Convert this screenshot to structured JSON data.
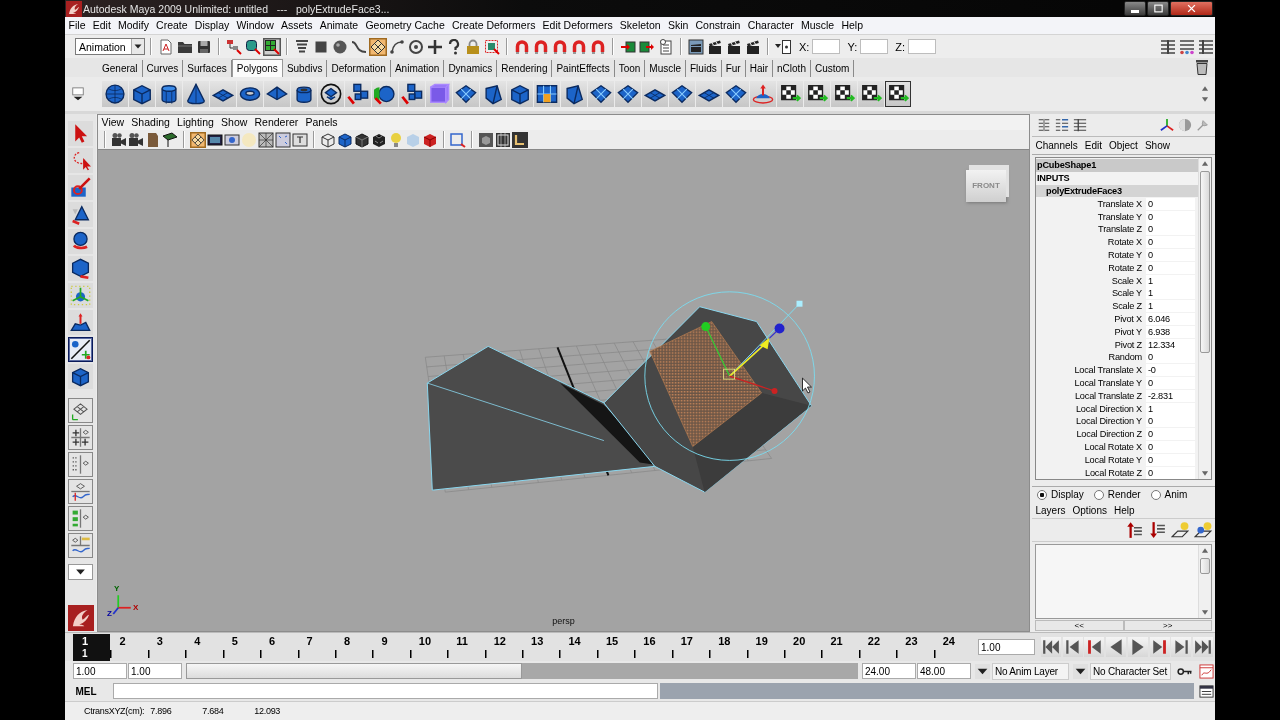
{
  "window": {
    "title": "Autodesk Maya 2009 Unlimited: untitled   ---   polyExtrudeFace3..."
  },
  "menu_bar": [
    "File",
    "Edit",
    "Modify",
    "Create",
    "Display",
    "Window",
    "Assets",
    "Animate",
    "Geometry Cache",
    "Create Deformers",
    "Edit Deformers",
    "Skeleton",
    "Skin",
    "Constrain",
    "Character",
    "Muscle",
    "Help"
  ],
  "status_line": {
    "menu_set": "Animation",
    "selection_modes": [
      {
        "selected": false
      },
      {
        "selected": false
      },
      {
        "selected": true
      }
    ],
    "snap_buttons": [
      {
        "on": true
      },
      {
        "on": false
      },
      {
        "on": false
      }
    ],
    "coordinate_fields": [
      {
        "label": "X:"
      },
      {
        "label": "Y:"
      },
      {
        "label": "Z:"
      }
    ]
  },
  "shelf": {
    "tabs": [
      {
        "label": "General",
        "selected": false
      },
      {
        "label": "Curves",
        "selected": false
      },
      {
        "label": "Surfaces",
        "selected": false
      },
      {
        "label": "Polygons",
        "selected": true
      },
      {
        "label": "Subdivs",
        "selected": false
      },
      {
        "label": "Deformation",
        "selected": false
      },
      {
        "label": "Animation",
        "selected": false
      },
      {
        "label": "Dynamics",
        "selected": false
      },
      {
        "label": "Rendering",
        "selected": false
      },
      {
        "label": "PaintEffects",
        "selected": false
      },
      {
        "label": "Toon",
        "selected": false
      },
      {
        "label": "Muscle",
        "selected": false
      },
      {
        "label": "Fluids",
        "selected": false
      },
      {
        "label": "Fur",
        "selected": false
      },
      {
        "label": "Hair",
        "selected": false
      },
      {
        "label": "nCloth",
        "selected": false
      },
      {
        "label": "Custom",
        "selected": false
      }
    ]
  },
  "toolbox": {
    "tools": [
      {
        "selected": false
      },
      {
        "selected": false
      },
      {
        "selected": false
      },
      {
        "selected": false
      },
      {
        "selected": false
      },
      {
        "selected": false
      },
      {
        "selected": false
      },
      {
        "selected": false
      },
      {
        "selected": true
      },
      {
        "selected": false
      }
    ]
  },
  "viewport": {
    "menu": [
      "View",
      "Shading",
      "Lighting",
      "Show",
      "Renderer",
      "Panels"
    ],
    "toolbar_toggles": [
      {
        "on": true
      },
      {
        "on": false
      },
      {
        "on": false
      },
      {
        "on": false
      }
    ],
    "view_cube_label": "FRONT",
    "camera_label": "persp",
    "axis_labels": [
      "Y",
      "X",
      "Z"
    ]
  },
  "channel_box": {
    "menu": [
      "Channels",
      "Edit",
      "Object",
      "Show"
    ],
    "shape": "pCubeShape1",
    "section": "INPUTS",
    "node": "polyExtrudeFace3",
    "attributes": [
      {
        "name": "Translate X",
        "value": "0"
      },
      {
        "name": "Translate Y",
        "value": "0"
      },
      {
        "name": "Translate Z",
        "value": "0"
      },
      {
        "name": "Rotate X",
        "value": "0"
      },
      {
        "name": "Rotate Y",
        "value": "0"
      },
      {
        "name": "Rotate Z",
        "value": "0"
      },
      {
        "name": "Scale X",
        "value": "1"
      },
      {
        "name": "Scale Y",
        "value": "1"
      },
      {
        "name": "Scale Z",
        "value": "1"
      },
      {
        "name": "Pivot X",
        "value": "6.046"
      },
      {
        "name": "Pivot Y",
        "value": "6.938"
      },
      {
        "name": "Pivot Z",
        "value": "12.334"
      },
      {
        "name": "Random",
        "value": "0"
      },
      {
        "name": "Local Translate X",
        "value": "-0"
      },
      {
        "name": "Local Translate Y",
        "value": "0"
      },
      {
        "name": "Local Translate Z",
        "value": "-2.831"
      },
      {
        "name": "Local Direction X",
        "value": "1"
      },
      {
        "name": "Local Direction Y",
        "value": "0"
      },
      {
        "name": "Local Direction Z",
        "value": "0"
      },
      {
        "name": "Local Rotate X",
        "value": "0"
      },
      {
        "name": "Local Rotate Y",
        "value": "0"
      },
      {
        "name": "Local Rotate Z",
        "value": "0"
      }
    ]
  },
  "layer_editor": {
    "modes": [
      {
        "label": "Display",
        "selected": true
      },
      {
        "label": "Render",
        "selected": false
      },
      {
        "label": "Anim",
        "selected": false
      }
    ],
    "menu": [
      "Layers",
      "Options",
      "Help"
    ],
    "pager": [
      "<<",
      ">>"
    ]
  },
  "time_slider": {
    "frames": [
      {
        "label": "1",
        "selected": true
      },
      {
        "label": "2",
        "selected": false
      },
      {
        "label": "3",
        "selected": false
      },
      {
        "label": "4",
        "selected": false
      },
      {
        "label": "5",
        "selected": false
      },
      {
        "label": "6",
        "selected": false
      },
      {
        "label": "7",
        "selected": false
      },
      {
        "label": "8",
        "selected": false
      },
      {
        "label": "9",
        "selected": false
      },
      {
        "label": "10",
        "selected": false
      },
      {
        "label": "11",
        "selected": false
      },
      {
        "label": "12",
        "selected": false
      },
      {
        "label": "13",
        "selected": false
      },
      {
        "label": "14",
        "selected": false
      },
      {
        "label": "15",
        "selected": false
      },
      {
        "label": "16",
        "selected": false
      },
      {
        "label": "17",
        "selected": false
      },
      {
        "label": "18",
        "selected": false
      },
      {
        "label": "19",
        "selected": false
      },
      {
        "label": "20",
        "selected": false
      },
      {
        "label": "21",
        "selected": false
      },
      {
        "label": "22",
        "selected": false
      },
      {
        "label": "23",
        "selected": false
      },
      {
        "label": "24",
        "selected": false
      }
    ],
    "current_frame": "1",
    "current_time": "1.00"
  },
  "range_slider": {
    "start_time": "1.00",
    "range_start": "1.00",
    "level": 0.5,
    "range_end": "24.00",
    "end_time": "48.00",
    "anim_layer": "No Anim Layer",
    "character_set": "No Character Set"
  },
  "command_line": {
    "language": "MEL"
  },
  "help_line": {
    "label": "CtransXYZ(cm):",
    "values": [
      "7.896",
      "7.684",
      "12.093"
    ]
  }
}
